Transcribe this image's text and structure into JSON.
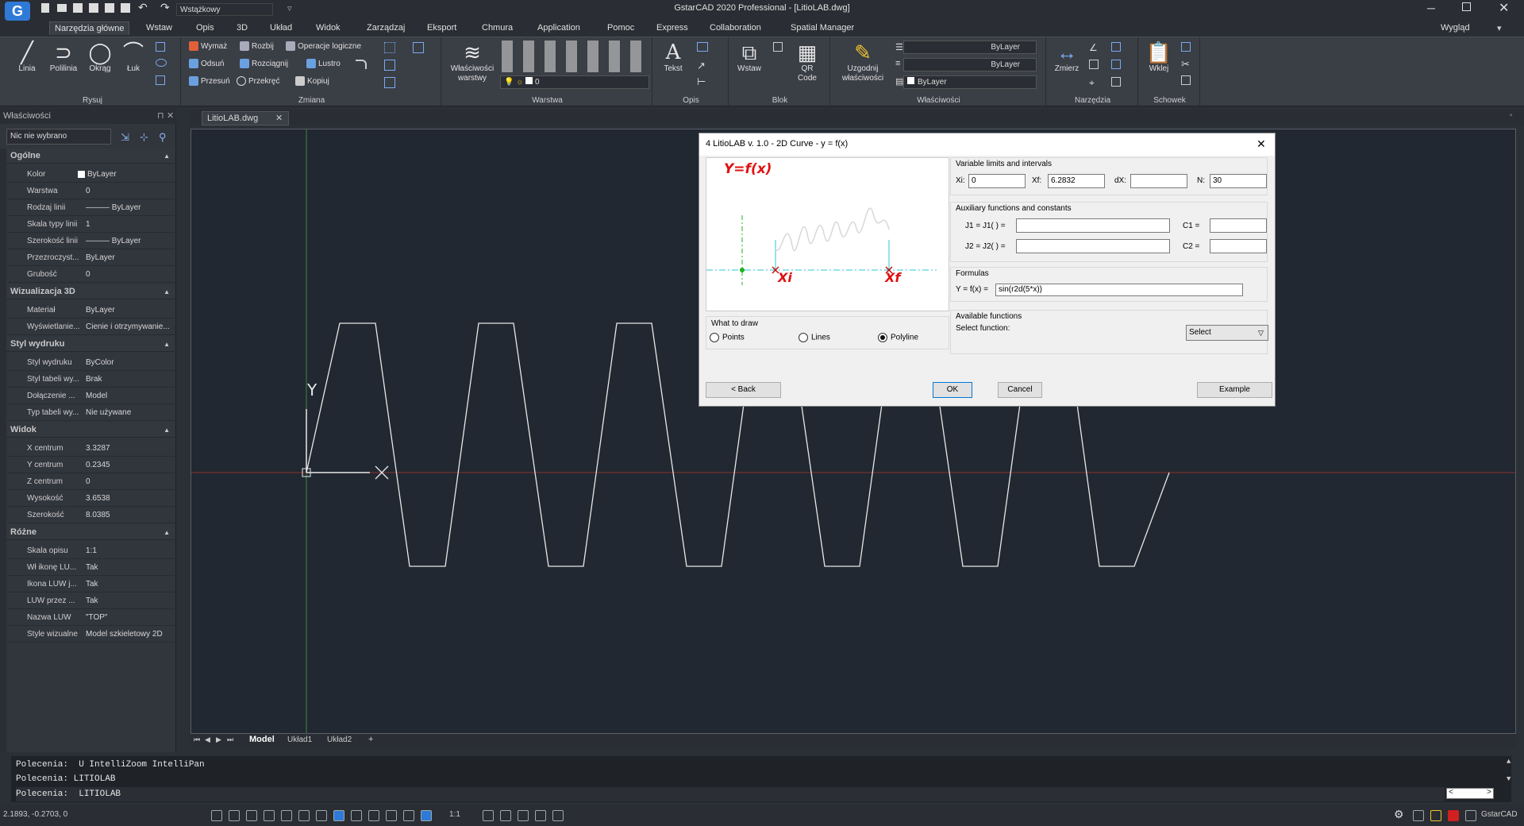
{
  "app": {
    "title": "GstarCAD 2020 Professional - [LitioLAB.dwg]",
    "workspace": "Wstążkowy",
    "view_label": "Wygląd"
  },
  "colors": {
    "accent": "#2f7ad6",
    "canvas_bg": "#212831",
    "ribbon_bg": "#3a3e45",
    "dialog_bg": "#f0f0f0",
    "label_red": "#e01010"
  },
  "menu": [
    "Narzędzia główne",
    "Wstaw",
    "Opis",
    "3D",
    "Układ",
    "Widok",
    "Zarządzaj",
    "Eksport",
    "Chmura",
    "Application",
    "Pomoc",
    "Express",
    "Collaboration",
    "Spatial Manager"
  ],
  "ribbon": {
    "rysuj": {
      "label": "Rysuj",
      "tools": [
        "Linia",
        "Polilinia",
        "Okrąg",
        "Łuk"
      ]
    },
    "zmiana": {
      "label": "Zmiana",
      "tools": [
        "Wymaż",
        "Rozbij",
        "Operacje logiczne",
        "Odsuń",
        "Rozciągnij",
        "Lustro",
        "Przesuń",
        "Przekręć",
        "Kopiuj"
      ]
    },
    "warstwa": {
      "label": "Warstwa",
      "big": "Właściwości warstwy",
      "layer_value": "0"
    },
    "opis": {
      "label": "Opis",
      "big": "Tekst"
    },
    "blok": {
      "label": "Blok",
      "tools": [
        "Wstaw",
        "QR Code"
      ]
    },
    "wlasciwosci": {
      "label": "Właściwości",
      "big": "Uzgodnij właściwości",
      "color": "ByLayer",
      "linetype": "ByLayer",
      "lineweight": "ByLayer"
    },
    "narzedzia": {
      "label": "Narzędzia",
      "big": "Zmierz"
    },
    "schowek": {
      "label": "Schowek",
      "big": "Wklej"
    }
  },
  "properties": {
    "header": "Właściwości",
    "selection": "Nic nie wybrano",
    "sections": [
      {
        "title": "Ogólne",
        "rows": [
          [
            "Kolor",
            "ByLayer"
          ],
          [
            "Warstwa",
            "0"
          ],
          [
            "Rodzaj linii",
            "——— ByLayer"
          ],
          [
            "Skala typy linii",
            "1"
          ],
          [
            "Szerokość linii",
            "——— ByLayer"
          ],
          [
            "Przezroczyst...",
            "ByLayer"
          ],
          [
            "Grubość",
            "0"
          ]
        ]
      },
      {
        "title": "Wizualizacja 3D",
        "rows": [
          [
            "Materiał",
            "ByLayer"
          ],
          [
            "Wyświetlanie...",
            "Cienie i otrzymywanie..."
          ]
        ]
      },
      {
        "title": "Styl wydruku",
        "rows": [
          [
            "Styl wydruku",
            "ByColor"
          ],
          [
            "Styl tabeli wy...",
            "Brak"
          ],
          [
            "Dołączenie ...",
            "Model"
          ],
          [
            "Typ tabeli wy...",
            "Nie używane"
          ]
        ]
      },
      {
        "title": "Widok",
        "rows": [
          [
            "X centrum",
            "3.3287"
          ],
          [
            "Y centrum",
            "0.2345"
          ],
          [
            "Z centrum",
            "0"
          ],
          [
            "Wysokość",
            "3.6538"
          ],
          [
            "Szerokość",
            "8.0385"
          ]
        ]
      },
      {
        "title": "Różne",
        "rows": [
          [
            "Skala opisu",
            "1:1"
          ],
          [
            "Wł ikonę LU...",
            "Tak"
          ],
          [
            "Ikona LUW j...",
            "Tak"
          ],
          [
            "LUW przez ...",
            "Tak"
          ],
          [
            "Nazwa LUW",
            "\"TOP\""
          ],
          [
            "Style wizualne",
            "Model szkieletowy 2D"
          ]
        ]
      }
    ]
  },
  "doc_tab": "LitioLAB.dwg",
  "layout_tabs": [
    "Model",
    "Układ1",
    "Układ2",
    "+"
  ],
  "canvas": {
    "ucs_y": "Y",
    "ucs_x": "X"
  },
  "dialog": {
    "title": "4 LitioLAB v. 1.0 - 2D Curve - y = f(x)",
    "preview_caption": "Y=f(x)",
    "preview_xi": "Xi",
    "preview_xf": "Xf",
    "limits_title": "Variable limits and intervals",
    "xi_label": "Xi:",
    "xi_value": "0",
    "xf_label": "Xf:",
    "xf_value": "6.2832",
    "dx_label": "dX:",
    "dx_value": "",
    "n_label": "N:",
    "n_value": "30",
    "aux_title": "Auxiliary functions and constants",
    "j1_label": "J1 = J1( ) =",
    "j1_value": "",
    "j2_label": "J2 = J2( ) =",
    "j2_value": "",
    "c1_label": "C1 =",
    "c1_value": "",
    "c2_label": "C2 =",
    "c2_value": "",
    "formulas_title": "Formulas",
    "y_label": "Y = f(x) =",
    "y_value": "sin(r2d(5*x))",
    "draw_title": "What to draw",
    "opt_points": "Points",
    "opt_lines": "Lines",
    "opt_polyline": "Polyline",
    "selected_option": "Polyline",
    "avail_title": "Available functions",
    "select_label": "Select function:",
    "select_value": "Select",
    "back": "< Back",
    "ok": "OK",
    "cancel": "Cancel",
    "example": "Example"
  },
  "command_history": [
    "Polecenia:  U IntelliZoom IntelliPan",
    "Polecenia: LITIOLAB",
    "Polecenia:  LITIOLAB"
  ],
  "status": {
    "coords": "2.1893, -0.2703, 0",
    "scale": "1:1",
    "product": "GstarCAD"
  }
}
